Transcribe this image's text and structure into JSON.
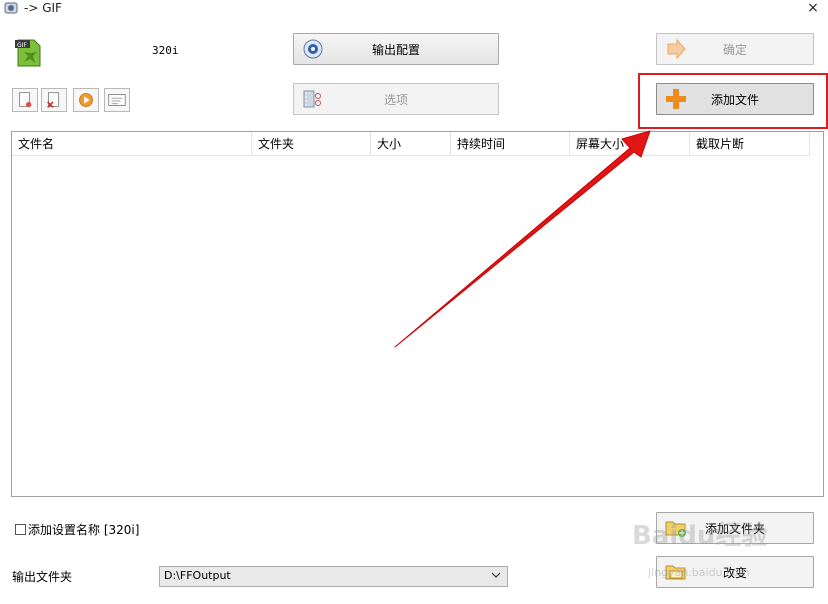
{
  "window": {
    "title": "-> GIF",
    "close_glyph": "×"
  },
  "header": {
    "preset": "320i"
  },
  "buttons": {
    "output_config": "输出配置",
    "confirm": "确定",
    "options": "选项",
    "add_file": "添加文件",
    "add_folder": "添加文件夹",
    "change": "改变"
  },
  "toolbar_icons": [
    "clear-list-icon",
    "delete-icon",
    "play-icon",
    "media-info-icon"
  ],
  "table": {
    "columns": [
      "文件名",
      "文件夹",
      "大小",
      "持续时间",
      "屏幕大小",
      "截取片断"
    ],
    "rows": []
  },
  "bottom": {
    "add_setting_name_label": "添加设置名称 [320i]",
    "add_setting_name_checked": false,
    "output_folder_label": "输出文件夹",
    "output_folder_value": "D:\\FFOutput"
  },
  "watermark": {
    "text": "Baidu经验",
    "url": "jingyan.baidu.com"
  },
  "colors": {
    "highlight": "#d42020",
    "arrow": "#e01515",
    "accent_orange": "#f08a1c"
  }
}
